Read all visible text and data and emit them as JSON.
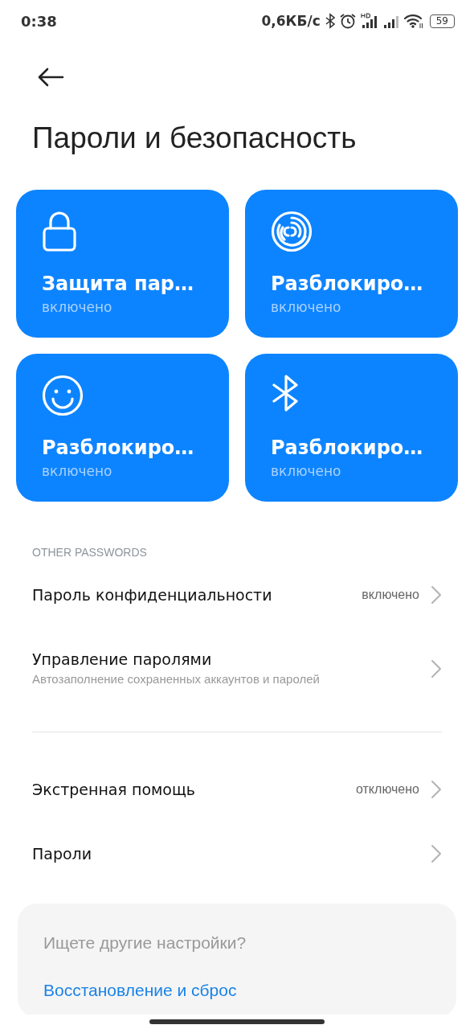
{
  "status_bar": {
    "time": "0:38",
    "speed": "0,6КБ/с",
    "battery": "59"
  },
  "title": "Пароли и безопасность",
  "cards": [
    {
      "kind": "lock",
      "title": "Защита пар…",
      "status": "включено"
    },
    {
      "kind": "fingerprint",
      "title": "Разблокиро…",
      "status": "включено"
    },
    {
      "kind": "face",
      "title": "Разблокиро…",
      "status": "включено"
    },
    {
      "kind": "bluetooth",
      "title": "Разблокиро…",
      "status": "включено"
    }
  ],
  "section_header": "OTHER PASSWORDS",
  "rows": [
    {
      "title": "Пароль конфиденциальности",
      "value": "включено"
    },
    {
      "title": "Управление паролями",
      "subtitle": "Автозаполнение сохраненных аккаунтов и паролей"
    },
    {
      "kind": "divider"
    },
    {
      "title": "Экстренная помощь",
      "value": "отключено"
    },
    {
      "title": "Пароли"
    }
  ],
  "suggestion": {
    "question": "Ищете другие настройки?",
    "link": "Восстановление и сброс"
  }
}
